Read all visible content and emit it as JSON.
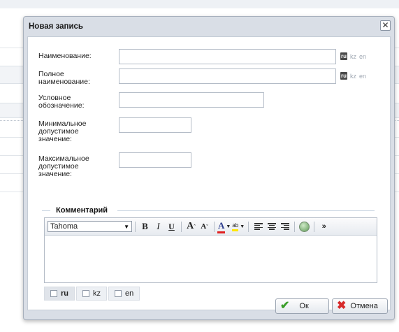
{
  "dialog": {
    "title": "Новая запись",
    "close_symbol": "✕"
  },
  "fields": {
    "name": {
      "label": "Наименование:",
      "value": ""
    },
    "full_name": {
      "label_line1": "Полное",
      "label_line2": "наименование:",
      "value": ""
    },
    "short": {
      "label_line1": "Условное",
      "label_line2": "обозначение:",
      "value": ""
    },
    "min": {
      "label_line1": "Минимальное",
      "label_line2": "допустимое",
      "label_line3": "значение:",
      "value": ""
    },
    "max": {
      "label_line1": "Максимальное",
      "label_line2": "допустимое",
      "label_line3": "значение:",
      "value": ""
    }
  },
  "languages": {
    "ru": "ru",
    "kz": "kz",
    "en": "en"
  },
  "comment": {
    "legend": "Комментарий",
    "font": "Tahoma",
    "toolbar": {
      "bold": "B",
      "italic": "I",
      "underline": "U",
      "grow": "A",
      "shrink": "A",
      "font_color": "A",
      "highlight": "ab",
      "more": "»"
    }
  },
  "lang_tabs": [
    {
      "label": "ru",
      "active": true
    },
    {
      "label": "kz",
      "active": false
    },
    {
      "label": "en",
      "active": false
    }
  ],
  "buttons": {
    "ok": "Ок",
    "cancel": "Отмена"
  },
  "icons": {
    "close": "close-icon",
    "ok": "checkmark-icon",
    "cancel": "cancel-x-icon",
    "source": "source-icon"
  }
}
